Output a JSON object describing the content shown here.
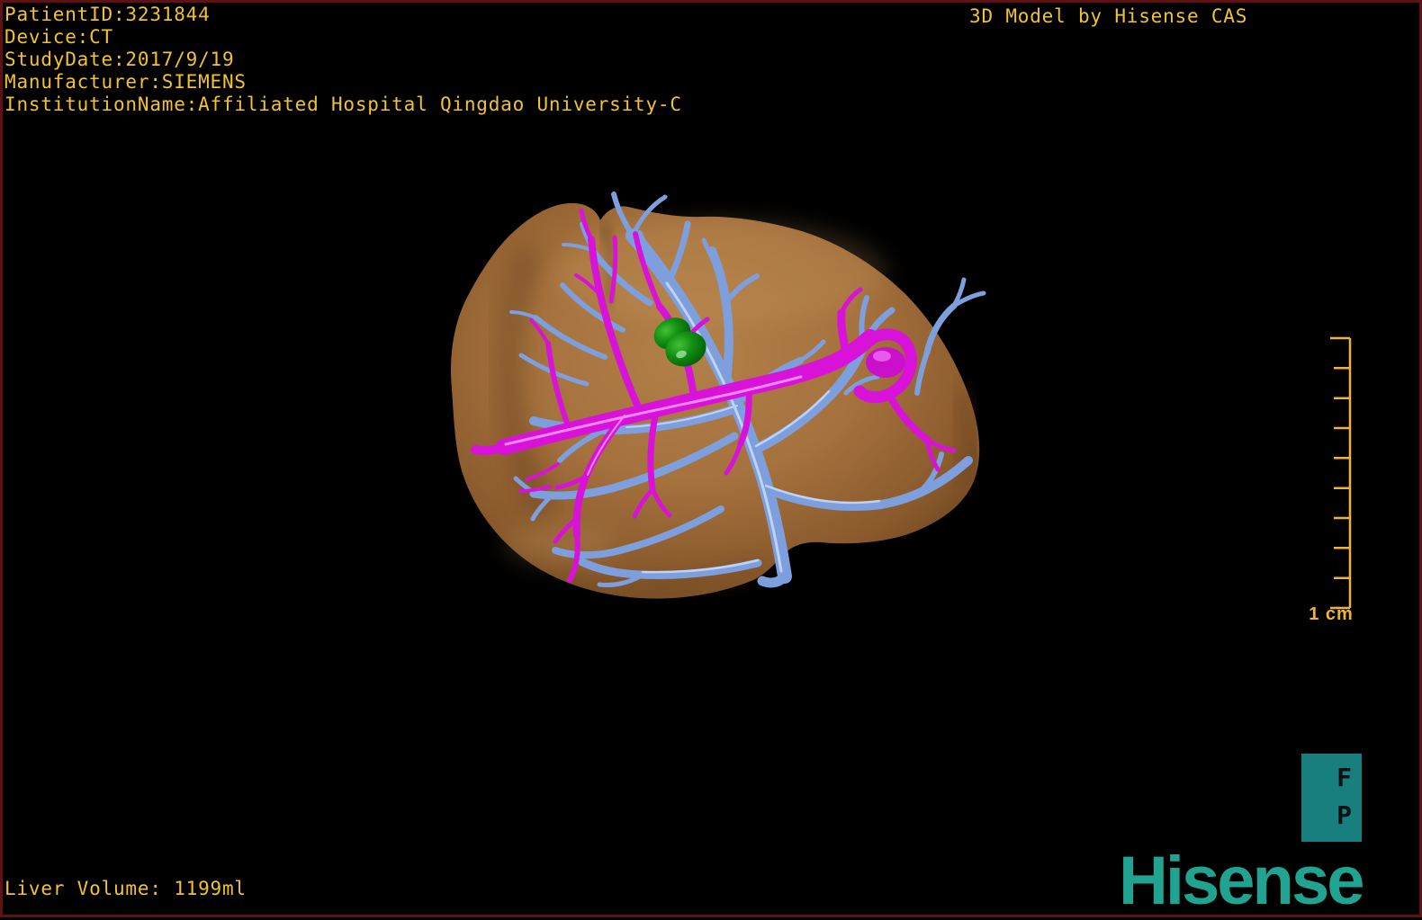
{
  "overlay": {
    "patient_lines": [
      "PatientID:3231844",
      "Device:CT",
      "StudyDate:2017/9/19",
      "Manufacturer:SIEMENS",
      "InstitutionName:Affiliated Hospital Qingdao University-C"
    ],
    "watermark": "3D Model by Hisense CAS",
    "liver_volume": "Liver Volume: 1199ml"
  },
  "scale_bar": {
    "label": "1 cm",
    "tick_count": 10
  },
  "orientation_marker": {
    "top_letter": "F",
    "bottom_letter": "P"
  },
  "brand": {
    "logo_text": "Hisense"
  },
  "model": {
    "description": "3D liver reconstruction with vasculature and tumor",
    "structures": [
      {
        "name": "liver-parenchyma",
        "color": "#a5713d"
      },
      {
        "name": "hepatic-veins",
        "color": "#7d9fdd"
      },
      {
        "name": "portal-vein",
        "color": "#d912d9"
      },
      {
        "name": "tumor",
        "color": "#0e8c0e"
      }
    ]
  },
  "colors": {
    "overlay_text": "#f2c231",
    "scalebar": "#eeb43a",
    "marker_teal": "#187f7e",
    "brand_teal": "#20a390",
    "border": "#601114",
    "background": "#000000"
  }
}
